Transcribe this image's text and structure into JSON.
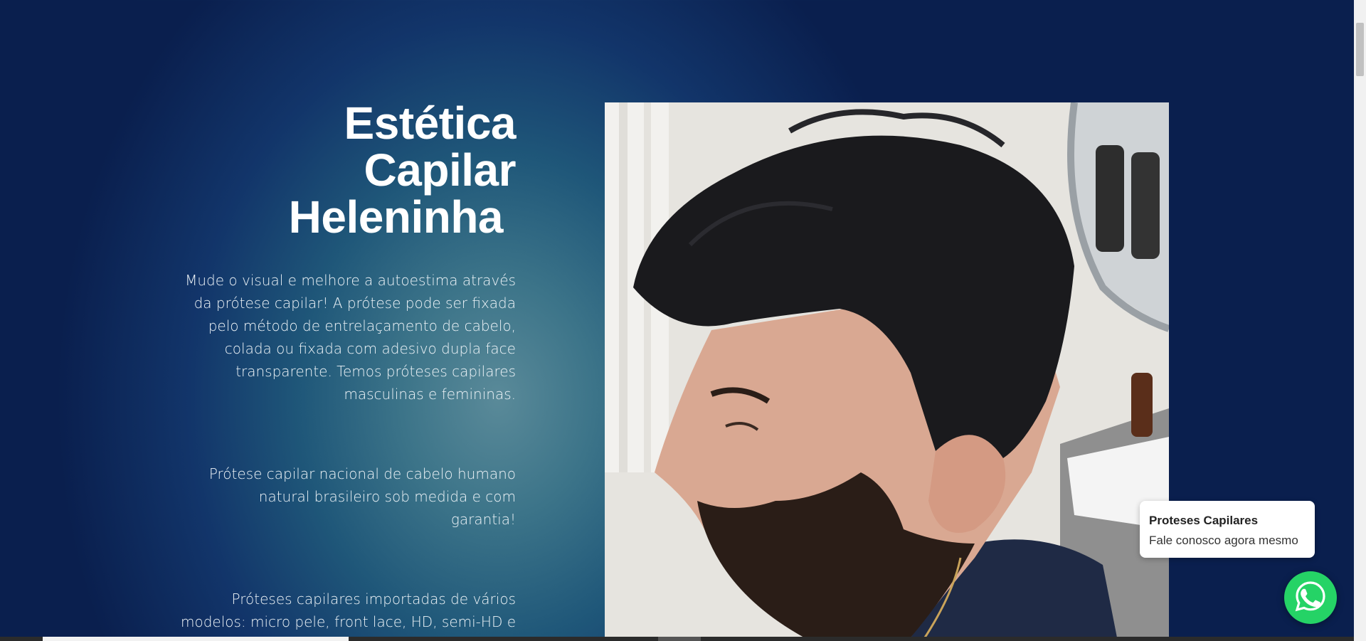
{
  "hero": {
    "title_lines": [
      "Estética",
      "Capilar",
      "Heleninha"
    ],
    "paragraphs": [
      "Mude o visual e melhore a autoestima através da prótese capilar! A prótese pode ser fixada pelo método de entrelaçamento de cabelo, colada ou fixada com adesivo dupla face transparente. Temos próteses capilares masculinas e femininas.",
      "Prótese capilar nacional de cabelo humano natural brasileiro sob medida e com garantia!",
      "Próteses capilares importadas de vários modelos: micro pele, front lace, HD, semi-HD e tela fina."
    ]
  },
  "chat_popup": {
    "title": "Proteses Capilares",
    "subtitle": "Fale conosco agora mesmo"
  },
  "icons": {
    "whatsapp": "whatsapp-icon"
  },
  "colors": {
    "background_dark": "#0a1f4e",
    "background_light": "#5a8a99",
    "whatsapp_green": "#25d366"
  }
}
